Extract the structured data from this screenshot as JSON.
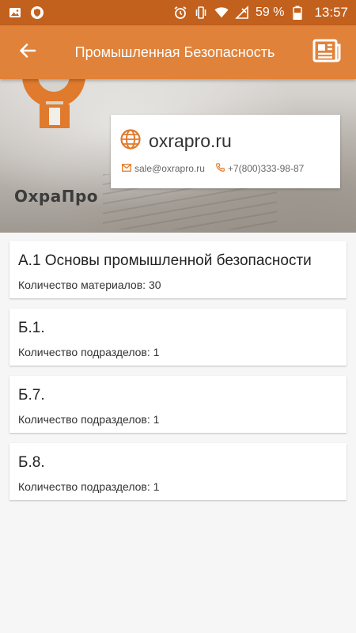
{
  "status_bar": {
    "battery": "59 %",
    "time": "13:57",
    "icons": [
      "image-icon",
      "shield-app-icon",
      "alarm-icon",
      "vibrate-icon",
      "wifi-icon",
      "signal-off-icon",
      "battery-icon"
    ]
  },
  "app_bar": {
    "title": "Промышленная Безопасность",
    "back_icon": "arrow-left-icon",
    "action_icon": "newspaper-icon"
  },
  "banner": {
    "logo_text": "ОхраПро",
    "site": "oxrapro.ru",
    "email": "sale@oxrapro.ru",
    "phone": "+7(800)333-98-87"
  },
  "items": [
    {
      "title": "А.1 Основы промышленной безопасности",
      "subtitle": "Количество материалов: 30"
    },
    {
      "title": "Б.1.",
      "subtitle": "Количество подразделов: 1"
    },
    {
      "title": "Б.7.",
      "subtitle": "Количество подразделов: 1"
    },
    {
      "title": "Б.8.",
      "subtitle": "Количество подразделов: 1"
    }
  ],
  "colors": {
    "accent": "#e0823a",
    "status_bar": "#c2601d",
    "logo": "#e07a2c"
  }
}
